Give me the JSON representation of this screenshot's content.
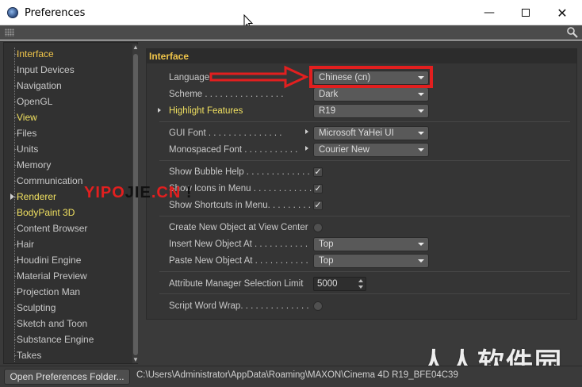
{
  "window": {
    "title": "Preferences"
  },
  "sidebar": {
    "items": [
      {
        "label": "Interface",
        "state": "active"
      },
      {
        "label": "Input Devices"
      },
      {
        "label": "Navigation"
      },
      {
        "label": "OpenGL"
      },
      {
        "label": "View",
        "state": "highlight"
      },
      {
        "label": "Files"
      },
      {
        "label": "Units"
      },
      {
        "label": "Memory"
      },
      {
        "label": "Communication"
      },
      {
        "label": "Renderer",
        "state": "highlight",
        "expandable": true
      },
      {
        "label": "BodyPaint 3D",
        "state": "highlight"
      },
      {
        "label": "Content Browser"
      },
      {
        "label": "Hair"
      },
      {
        "label": "Houdini Engine"
      },
      {
        "label": "Material Preview"
      },
      {
        "label": "Projection Man"
      },
      {
        "label": "Sculpting"
      },
      {
        "label": "Sketch and Toon"
      },
      {
        "label": "Substance Engine"
      },
      {
        "label": "Takes"
      }
    ]
  },
  "panel": {
    "header": "Interface",
    "language": {
      "label": "Language . . . . . . . . . . . . . . .",
      "value": "Chinese (cn)"
    },
    "scheme": {
      "label": "Scheme . . . . . . . . . . . . . . . .",
      "value": "Dark"
    },
    "highlight": {
      "label": "Highlight Features",
      "value": "R19"
    },
    "gui_font": {
      "label": "GUI Font . . . . . . . . . . . . . . .",
      "value": "Microsoft YaHei UI"
    },
    "mono_font": {
      "label": "Monospaced Font . . . . . . . . . . .",
      "value": "Courier New"
    },
    "bubble_help": {
      "label": "Show Bubble Help . . . . . . . . . . . . .",
      "checked": true
    },
    "icons_menu": {
      "label": "Show Icons in Menu . . . . . . . . . . . .",
      "checked": true
    },
    "shortcuts_menu": {
      "label": "Show Shortcuts in Menu. . . . . . . . . . .",
      "checked": true
    },
    "create_center": {
      "label": "Create New Object at View Center",
      "checked": false
    },
    "insert_at": {
      "label": "Insert New Object At . . . . . . . . . . .",
      "value": "Top"
    },
    "paste_at": {
      "label": "Paste New Object At . . . . . . . . . . .",
      "value": "Top"
    },
    "attr_limit": {
      "label": "Attribute Manager Selection Limit",
      "value": "5000"
    },
    "script_wrap": {
      "label": "Script Word Wrap. . . . . . . . . . . . . .",
      "checked": false
    }
  },
  "footer": {
    "open_button": "Open Preferences Folder...",
    "path": "C:\\Users\\Administrator\\AppData\\Roaming\\MAXON\\Cinema 4D R19_BFE04C39"
  },
  "watermarks": {
    "yipojie_red_1": "YIPO",
    "yipojie_dark": "JIE",
    "yipojie_red_2": ".CN",
    "yipojie_bang": " !",
    "site": "人人软件园"
  },
  "colors": {
    "accent": "#f0c54a",
    "highlight": "#f0e060",
    "annotation": "#e21f1f",
    "panel_bg": "#353535",
    "window_bg": "#3a3a3a"
  },
  "check_glyph": "✓",
  "close_glyph": "✕",
  "min_glyph": "—"
}
